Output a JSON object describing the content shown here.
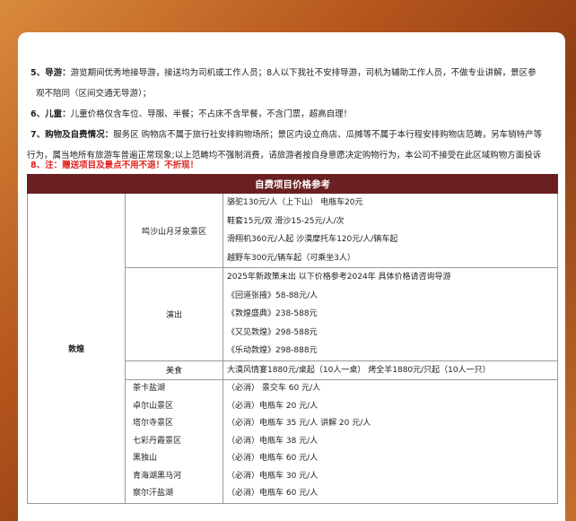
{
  "notes": [
    {
      "label": "5、导游：",
      "text": "游览期间优秀地接导游，接送均为司机或工作人员；8人以下我社不安排导游，司机为辅助工作人员，不做专业讲解，景区参"
    },
    {
      "label": "",
      "text": "观不陪同（区间交通无导游）；"
    },
    {
      "label": "6、儿童：",
      "text": "儿童价格仅含车位、导服、半餐；不占床不含早餐，不含门票，超高自理！"
    },
    {
      "label": "7、购物及自费情况：",
      "text": "服务区 购物店不属于旅行社安排购物场所；景区内设立商店、瓜摊等不属于本行程安排购物店范畴，另车销特产等"
    },
    {
      "label": "",
      "text": "行为，属当地所有旅游车普遍正常现象;以上范畴均不强制消费，请旅游者按自身意愿决定购物行为，本公司不接受在此区域购物方面投诉"
    }
  ],
  "warning": "8、注：赠送项目及景点不用不退！不折现！",
  "table": {
    "header": "自费项目价格参考",
    "region": "敦煌",
    "mingsha": {
      "name": "鸣沙山月牙泉景区",
      "items": [
        "骆驼130元/人（上下山） 电瓶车20元",
        "鞋套15元/双 滑沙15-25元/人/次",
        "滑翔机360元/人起 沙漠摩托车120元/人/辆车起",
        "越野车300元/辆车起（可乘坐3人）"
      ]
    },
    "show": {
      "name": "演出",
      "items": [
        "2025年新政策未出 以下价格参考2024年 具体价格请咨询导游",
        "《回道张掖》58-88元/人",
        "《敦煌盛典》238-588元",
        "《又见敦煌》298-588元",
        "《乐动敦煌》298-888元"
      ]
    },
    "food": {
      "name": "美食",
      "text": "大漠风情宴1880元/桌起（10人一桌） 烤全羊1880元/只起（10人一只）"
    },
    "spots": [
      {
        "name": "茶卡盐湖",
        "text": "（必消） 景交车 60 元/人"
      },
      {
        "name": "卓尔山景区",
        "text": "（必消）电瓶车 20 元/人"
      },
      {
        "name": "塔尔寺景区",
        "text": "（必消）电瓶车 35 元/人 讲解 20 元/人"
      },
      {
        "name": "七彩丹霞景区",
        "text": "（必消）电瓶车 38 元/人"
      },
      {
        "name": "黑独山",
        "text": "（必消）电瓶车 60 元/人"
      },
      {
        "name": "青海湖黑马河",
        "text": "（必消）电瓶车 30 元/人"
      },
      {
        "name": "察尔汗盐湖",
        "text": "（必消）电瓶车 60 元/人"
      }
    ]
  }
}
